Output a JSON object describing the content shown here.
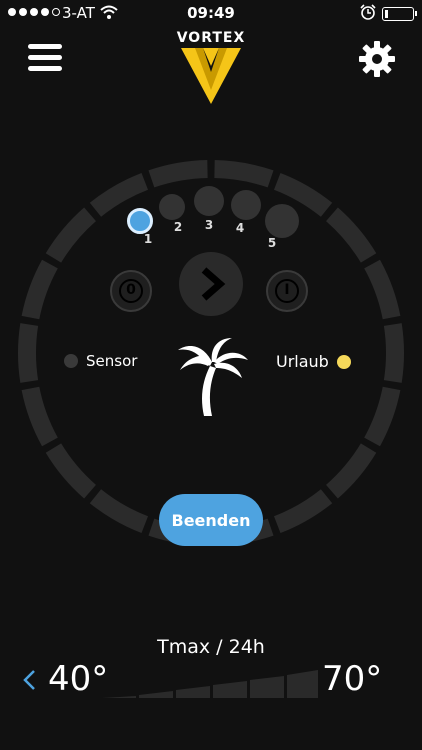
{
  "status_bar": {
    "carrier": "3-AT",
    "time": "09:49",
    "signal_bars_filled": 4,
    "signal_bars_total": 5,
    "battery_level": 0.1
  },
  "header": {
    "logo_text": "VORTEX",
    "menu_icon": "hamburger-icon",
    "settings_icon": "gear-icon",
    "accent_color": "#f5c518"
  },
  "controller": {
    "steps": [
      {
        "label": "1",
        "active": true
      },
      {
        "label": "2",
        "active": false
      },
      {
        "label": "3",
        "active": false
      },
      {
        "label": "4",
        "active": false
      },
      {
        "label": "5",
        "active": false
      }
    ],
    "off_label": "0",
    "on_label": "I",
    "sensor_label": "Sensor",
    "holiday_label": "Urlaub",
    "holiday_indicator_color": "#f5d85a",
    "mode_icon": "palm-tree-icon",
    "end_button_label": "Beenden",
    "accent_color": "#4ea3e0"
  },
  "temperature": {
    "title": "Tmax / 24h",
    "low_value": "40°",
    "high_value": "70°"
  }
}
